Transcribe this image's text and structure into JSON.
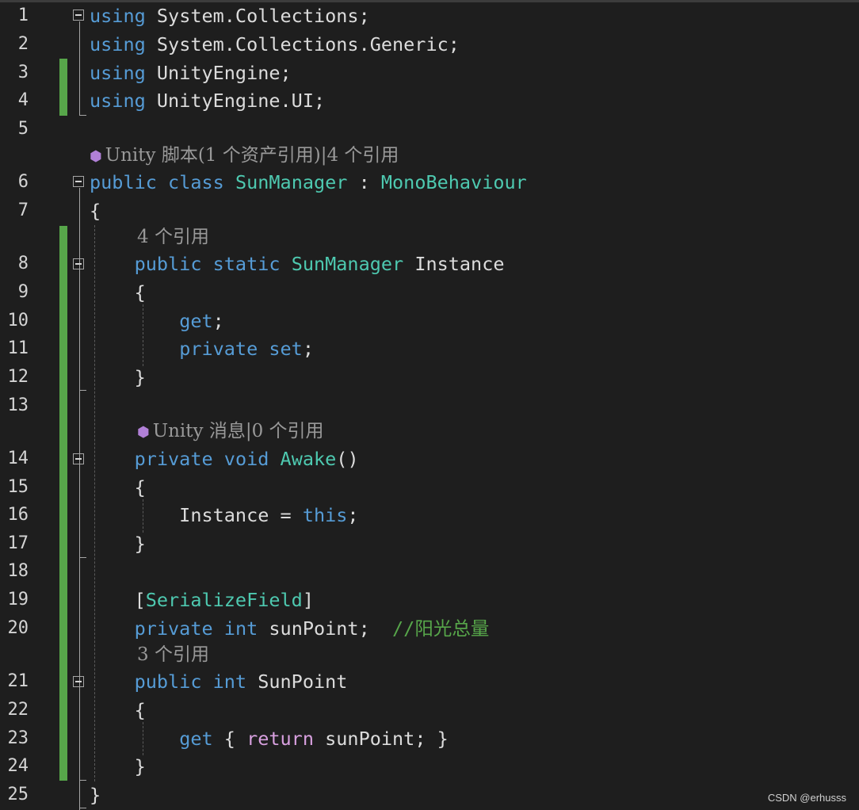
{
  "editor": {
    "line_numbers": [
      "1",
      "2",
      "3",
      "4",
      "5",
      "6",
      "7",
      "8",
      "9",
      "10",
      "11",
      "12",
      "13",
      "14",
      "15",
      "16",
      "17",
      "18",
      "19",
      "20",
      "21",
      "22",
      "23",
      "24",
      "25"
    ],
    "codelens": [
      {
        "icon": "unity-cube-icon",
        "text": "Unity 脚本(1 个资产引用)|4 个引用"
      },
      {
        "icon": "",
        "text": "4 个引用"
      },
      {
        "icon": "unity-cube-icon",
        "text": "Unity 消息|0 个引用"
      },
      {
        "icon": "",
        "text": "3 个引用"
      }
    ],
    "lines": [
      [
        {
          "t": "using",
          "c": "kw"
        },
        {
          "t": " System.Collections;",
          "c": ""
        }
      ],
      [
        {
          "t": "using",
          "c": "kw"
        },
        {
          "t": " System.Collections.Generic;",
          "c": ""
        }
      ],
      [
        {
          "t": "using",
          "c": "kw"
        },
        {
          "t": " UnityEngine;",
          "c": ""
        }
      ],
      [
        {
          "t": "using",
          "c": "kw"
        },
        {
          "t": " UnityEngine.UI;",
          "c": ""
        }
      ],
      [],
      [
        {
          "t": "public",
          "c": "kw"
        },
        {
          "t": " ",
          "c": ""
        },
        {
          "t": "class",
          "c": "kw"
        },
        {
          "t": " ",
          "c": ""
        },
        {
          "t": "SunManager",
          "c": "ty"
        },
        {
          "t": " : ",
          "c": ""
        },
        {
          "t": "MonoBehaviour",
          "c": "ty"
        }
      ],
      [
        {
          "t": "{",
          "c": ""
        }
      ],
      [
        {
          "t": "    ",
          "c": ""
        },
        {
          "t": "public",
          "c": "kw"
        },
        {
          "t": " ",
          "c": ""
        },
        {
          "t": "static",
          "c": "kw"
        },
        {
          "t": " ",
          "c": ""
        },
        {
          "t": "SunManager",
          "c": "ty"
        },
        {
          "t": " Instance",
          "c": ""
        }
      ],
      [
        {
          "t": "    {",
          "c": ""
        }
      ],
      [
        {
          "t": "        ",
          "c": ""
        },
        {
          "t": "get",
          "c": "kw"
        },
        {
          "t": ";",
          "c": ""
        }
      ],
      [
        {
          "t": "        ",
          "c": ""
        },
        {
          "t": "private",
          "c": "kw"
        },
        {
          "t": " ",
          "c": ""
        },
        {
          "t": "set",
          "c": "kw"
        },
        {
          "t": ";",
          "c": ""
        }
      ],
      [
        {
          "t": "    }",
          "c": ""
        }
      ],
      [],
      [
        {
          "t": "    ",
          "c": ""
        },
        {
          "t": "private",
          "c": "kw"
        },
        {
          "t": " ",
          "c": ""
        },
        {
          "t": "void",
          "c": "kw"
        },
        {
          "t": " ",
          "c": ""
        },
        {
          "t": "Awake",
          "c": "ty"
        },
        {
          "t": "()",
          "c": ""
        }
      ],
      [
        {
          "t": "    {",
          "c": ""
        }
      ],
      [
        {
          "t": "        Instance = ",
          "c": ""
        },
        {
          "t": "this",
          "c": "kw"
        },
        {
          "t": ";",
          "c": ""
        }
      ],
      [
        {
          "t": "    }",
          "c": ""
        }
      ],
      [],
      [
        {
          "t": "    [",
          "c": ""
        },
        {
          "t": "SerializeField",
          "c": "ty"
        },
        {
          "t": "]",
          "c": ""
        }
      ],
      [
        {
          "t": "    ",
          "c": ""
        },
        {
          "t": "private",
          "c": "kw"
        },
        {
          "t": " ",
          "c": ""
        },
        {
          "t": "int",
          "c": "kw"
        },
        {
          "t": " sunPoint;  ",
          "c": ""
        },
        {
          "t": "//阳光总量",
          "c": "cm"
        }
      ],
      [
        {
          "t": "    ",
          "c": ""
        },
        {
          "t": "public",
          "c": "kw"
        },
        {
          "t": " ",
          "c": ""
        },
        {
          "t": "int",
          "c": "kw"
        },
        {
          "t": " SunPoint",
          "c": ""
        }
      ],
      [
        {
          "t": "    {",
          "c": ""
        }
      ],
      [
        {
          "t": "        ",
          "c": ""
        },
        {
          "t": "get",
          "c": "kw"
        },
        {
          "t": " { ",
          "c": ""
        },
        {
          "t": "return",
          "c": "ctl"
        },
        {
          "t": " sunPoint; }",
          "c": ""
        }
      ],
      [
        {
          "t": "    }",
          "c": ""
        }
      ],
      [
        {
          "t": "}",
          "c": ""
        }
      ]
    ]
  },
  "colors": {
    "background": "#1e1e1e",
    "keyword": "#569cd6",
    "type": "#4ec9b0",
    "control": "#d8a0df",
    "comment": "#57a64a",
    "change_bar": "#57a64a"
  },
  "watermark": "CSDN @erhusss"
}
